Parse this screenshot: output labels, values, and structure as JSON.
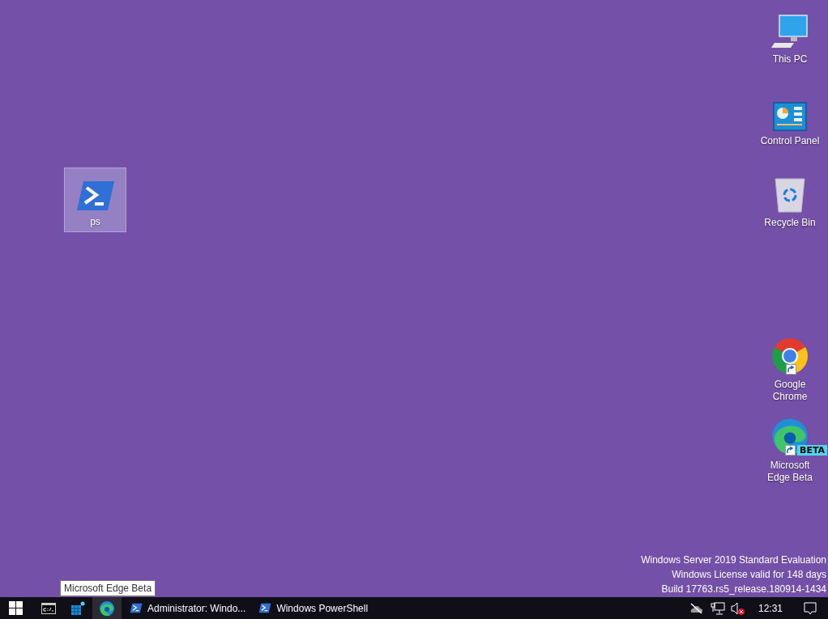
{
  "desktop_icons": [
    {
      "kind": "powershell",
      "label": "ps",
      "selected": true,
      "shortcut": false
    },
    {
      "kind": "computer",
      "label": "This PC",
      "selected": false,
      "shortcut": false
    },
    {
      "kind": "control-panel",
      "label": "Control Panel",
      "selected": false,
      "shortcut": false
    },
    {
      "kind": "recycle-bin",
      "label": "Recycle Bin",
      "selected": false,
      "shortcut": false
    },
    {
      "kind": "chrome",
      "label": "Google Chrome",
      "selected": false,
      "shortcut": true
    },
    {
      "kind": "edge-beta",
      "label": "Microsoft Edge Beta",
      "badge": "BETA",
      "selected": false,
      "shortcut": true
    }
  ],
  "watermark": [
    "Windows Server 2019 Standard Evaluation",
    "Windows License valid for 148 days",
    "Build 17763.rs5_release.180914-1434"
  ],
  "tooltip": "Microsoft Edge Beta",
  "taskbar": {
    "pinned": [
      {
        "kind": "cmd",
        "hovered": false
      },
      {
        "kind": "server-manager",
        "hovered": false
      },
      {
        "kind": "edge-beta",
        "hovered": true
      }
    ],
    "tasks": [
      {
        "label": "Administrator: Windo...",
        "active": false
      },
      {
        "label": "Windows PowerShell",
        "active": false
      }
    ],
    "tray": {
      "onedrive_offline": true,
      "volume_muted": true,
      "clock": "12:31"
    }
  }
}
